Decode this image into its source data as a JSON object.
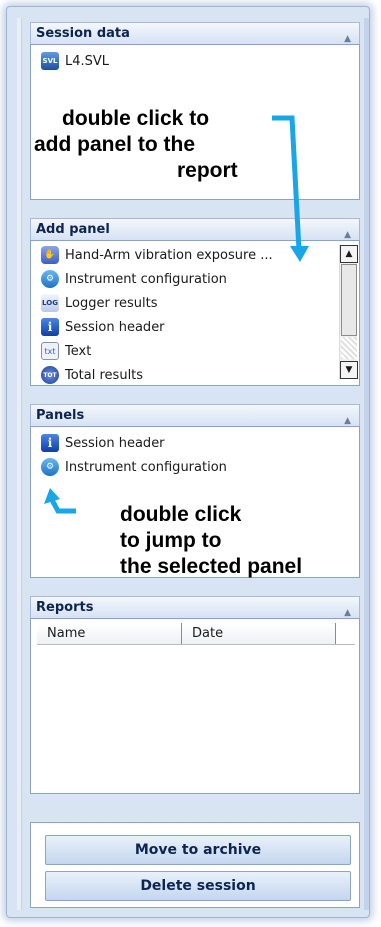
{
  "session_data": {
    "header": "Session data",
    "file": "L4.SVL",
    "file_icon": "svl-file-icon",
    "annotation": [
      "double click to",
      "add panel to the",
      "report"
    ]
  },
  "add_panel": {
    "header": "Add panel",
    "items": [
      {
        "label": "Hand-Arm vibration exposure ...",
        "icon": "hand-icon"
      },
      {
        "label": "Instrument configuration",
        "icon": "wrench-icon"
      },
      {
        "label": "Logger results",
        "icon": "log-icon"
      },
      {
        "label": "Session header",
        "icon": "info-icon"
      },
      {
        "label": "Text",
        "icon": "txt-icon"
      },
      {
        "label": "Total results",
        "icon": "tot-icon"
      }
    ]
  },
  "panels": {
    "header": "Panels",
    "items": [
      {
        "label": "Session header",
        "icon": "info-icon"
      },
      {
        "label": "Instrument configuration",
        "icon": "wrench-icon"
      }
    ],
    "annotation": [
      "double click",
      "to jump to",
      "the selected panel"
    ]
  },
  "reports": {
    "header": "Reports",
    "columns": [
      "Name",
      "Date"
    ]
  },
  "actions": {
    "move_to_archive": "Move to archive",
    "delete_session": "Delete session"
  },
  "colors": {
    "annotation_arrow": "#1aa6e6",
    "panel_header_text": "#0d2550"
  }
}
